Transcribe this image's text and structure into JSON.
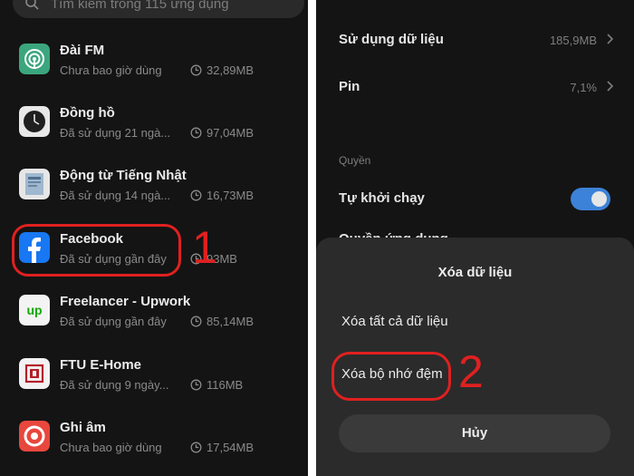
{
  "search": {
    "placeholder": "Tìm kiếm trong 115 ứng dụng"
  },
  "apps": [
    {
      "name": "Đài FM",
      "sub": "Chưa bao giờ dùng",
      "size": "32,89MB",
      "icon": "radio-icon"
    },
    {
      "name": "Đồng hồ",
      "sub": "Đã sử dụng 21 ngà...",
      "size": "97,04MB",
      "icon": "clock-app-icon"
    },
    {
      "name": "Động từ Tiếng Nhật",
      "sub": "Đã sử dụng 14 ngà...",
      "size": "16,73MB",
      "icon": "book-icon"
    },
    {
      "name": "Facebook",
      "sub": "Đã sử dụng gần đây",
      "size": "93MB",
      "icon": "facebook-icon"
    },
    {
      "name": "Freelancer - Upwork",
      "sub": "Đã sử dụng gần đây",
      "size": "85,14MB",
      "icon": "upwork-icon"
    },
    {
      "name": "FTU E-Home",
      "sub": "Đã sử dụng 9 ngày...",
      "size": "116MB",
      "icon": "ftu-icon"
    },
    {
      "name": "Ghi âm",
      "sub": "Chưa bao giờ dùng",
      "size": "17,54MB",
      "icon": "recorder-icon"
    }
  ],
  "settings": {
    "data_usage": {
      "label": "Sử dụng dữ liệu",
      "value": "185,9MB"
    },
    "battery": {
      "label": "Pin",
      "value": "7,1%"
    },
    "permissions_label": "Quyền",
    "autostart": {
      "label": "Tự khởi chạy",
      "enabled": true
    },
    "app_permissions": "Quyền ứng dụng"
  },
  "sheet": {
    "title": "Xóa dữ liệu",
    "option_clear_all": "Xóa tất cả dữ liệu",
    "option_clear_cache": "Xóa bộ nhớ đệm",
    "cancel": "Hủy"
  },
  "annotations": {
    "step1": "1",
    "step2": "2"
  },
  "colors": {
    "background": "#141414",
    "sheet": "#2b2b2b",
    "accent": "#3c82d8",
    "annotation": "#e02020"
  }
}
